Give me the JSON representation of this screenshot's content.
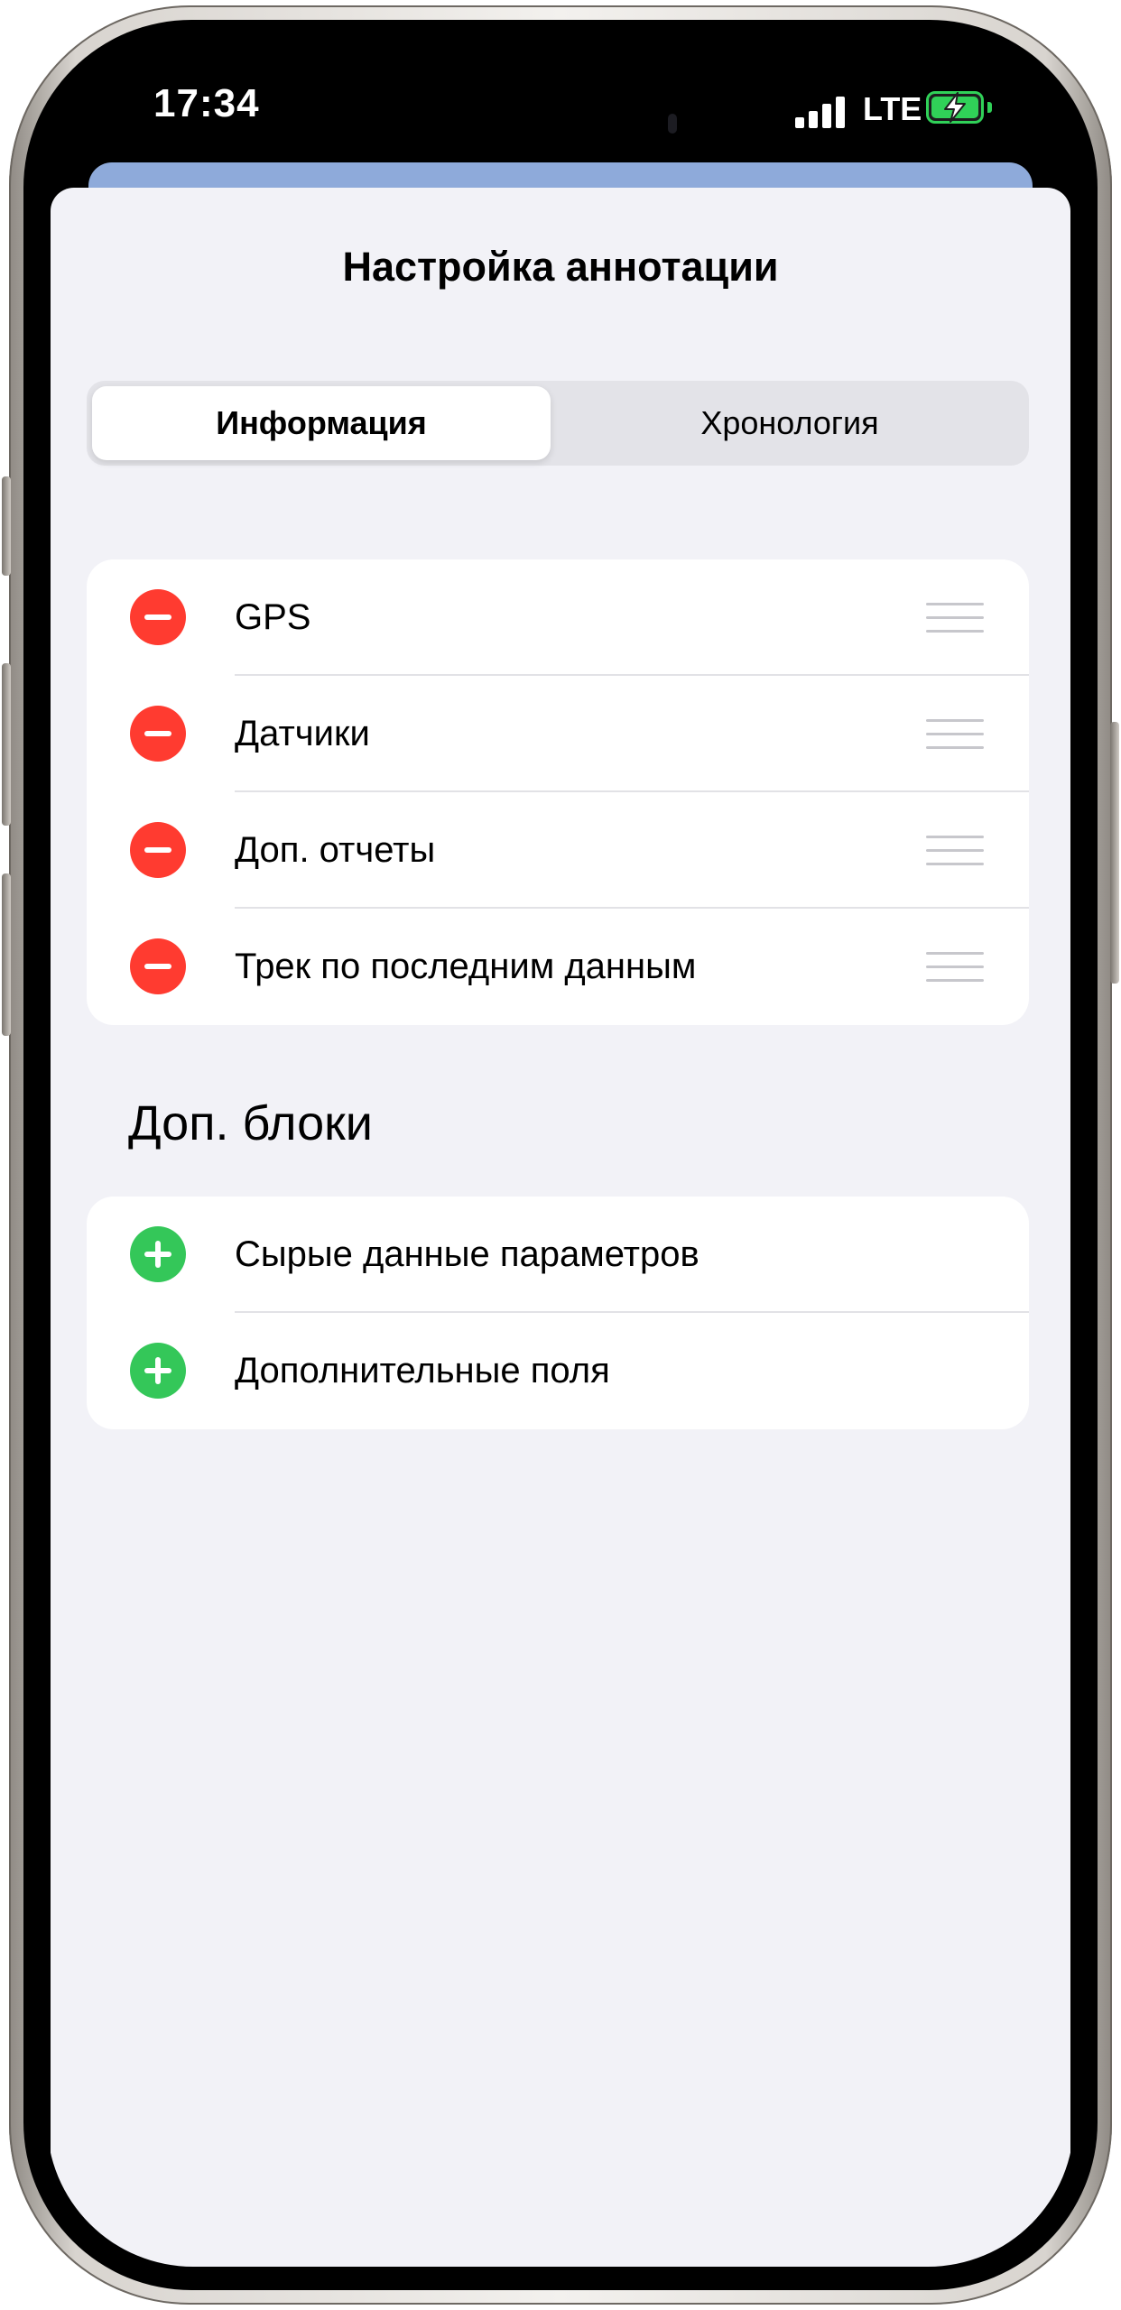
{
  "status_bar": {
    "time": "17:34",
    "network": "LTE",
    "signal_bars": 4,
    "battery_charging": true,
    "accent_color": "#30d158"
  },
  "sheet": {
    "title": "Настройка аннотации",
    "background_color": "#f2f2f7"
  },
  "segmented_control": {
    "segments": [
      {
        "label": "Информация",
        "selected": true
      },
      {
        "label": "Хронология",
        "selected": false
      }
    ]
  },
  "active_blocks": {
    "items": [
      {
        "label": "GPS",
        "icon": "remove-circle-icon"
      },
      {
        "label": "Датчики",
        "icon": "remove-circle-icon"
      },
      {
        "label": "Доп. отчеты",
        "icon": "remove-circle-icon"
      },
      {
        "label": "Трек по последним данным",
        "icon": "remove-circle-icon"
      }
    ],
    "remove_color": "#ff3b30"
  },
  "extra_blocks": {
    "header": "Доп. блоки",
    "items": [
      {
        "label": "Сырые данные параметров",
        "icon": "add-circle-icon"
      },
      {
        "label": "Дополнительные поля",
        "icon": "add-circle-icon"
      }
    ],
    "add_color": "#34c759"
  }
}
